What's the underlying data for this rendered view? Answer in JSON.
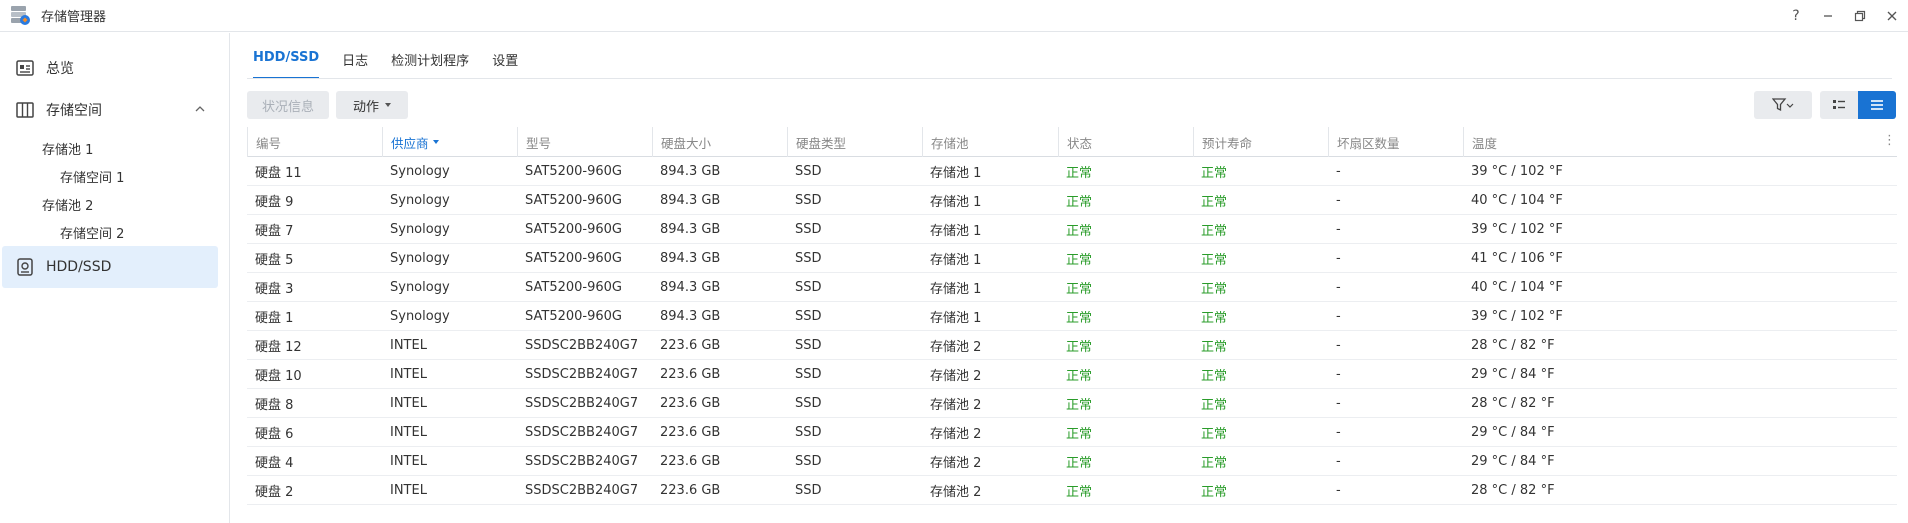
{
  "window": {
    "title": "存储管理器",
    "controls": [
      "help-icon",
      "minimize-icon",
      "restore-icon",
      "close-icon"
    ]
  },
  "sidebar": {
    "overview": "总览",
    "storage": "存储空间",
    "pools": [
      {
        "name": "存储池 1",
        "volume": "存储空间 1"
      },
      {
        "name": "存储池 2",
        "volume": "存储空间 2"
      }
    ],
    "hdd": "HDD/SSD"
  },
  "tabs": [
    "HDD/SSD",
    "日志",
    "检测计划程序",
    "设置"
  ],
  "toolbar": {
    "status_label": "状况信息",
    "action_label": "动作"
  },
  "table": {
    "columns": [
      "编号",
      "供应商",
      "型号",
      "硬盘大小",
      "硬盘类型",
      "存储池",
      "状态",
      "预计寿命",
      "坏扇区数量",
      "温度"
    ],
    "sorted_column": "供应商",
    "rows": [
      [
        "硬盘 11",
        "Synology",
        "SAT5200-960G",
        "894.3 GB",
        "SSD",
        "存储池 1",
        "正常",
        "正常",
        "-",
        "39 °C / 102 °F"
      ],
      [
        "硬盘 9",
        "Synology",
        "SAT5200-960G",
        "894.3 GB",
        "SSD",
        "存储池 1",
        "正常",
        "正常",
        "-",
        "40 °C / 104 °F"
      ],
      [
        "硬盘 7",
        "Synology",
        "SAT5200-960G",
        "894.3 GB",
        "SSD",
        "存储池 1",
        "正常",
        "正常",
        "-",
        "39 °C / 102 °F"
      ],
      [
        "硬盘 5",
        "Synology",
        "SAT5200-960G",
        "894.3 GB",
        "SSD",
        "存储池 1",
        "正常",
        "正常",
        "-",
        "41 °C / 106 °F"
      ],
      [
        "硬盘 3",
        "Synology",
        "SAT5200-960G",
        "894.3 GB",
        "SSD",
        "存储池 1",
        "正常",
        "正常",
        "-",
        "40 °C / 104 °F"
      ],
      [
        "硬盘 1",
        "Synology",
        "SAT5200-960G",
        "894.3 GB",
        "SSD",
        "存储池 1",
        "正常",
        "正常",
        "-",
        "39 °C / 102 °F"
      ],
      [
        "硬盘 12",
        "INTEL",
        "SSDSC2BB240G7",
        "223.6 GB",
        "SSD",
        "存储池 2",
        "正常",
        "正常",
        "-",
        "28 °C / 82 °F"
      ],
      [
        "硬盘 10",
        "INTEL",
        "SSDSC2BB240G7",
        "223.6 GB",
        "SSD",
        "存储池 2",
        "正常",
        "正常",
        "-",
        "29 °C / 84 °F"
      ],
      [
        "硬盘 8",
        "INTEL",
        "SSDSC2BB240G7",
        "223.6 GB",
        "SSD",
        "存储池 2",
        "正常",
        "正常",
        "-",
        "28 °C / 82 °F"
      ],
      [
        "硬盘 6",
        "INTEL",
        "SSDSC2BB240G7",
        "223.6 GB",
        "SSD",
        "存储池 2",
        "正常",
        "正常",
        "-",
        "29 °C / 84 °F"
      ],
      [
        "硬盘 4",
        "INTEL",
        "SSDSC2BB240G7",
        "223.6 GB",
        "SSD",
        "存储池 2",
        "正常",
        "正常",
        "-",
        "29 °C / 84 °F"
      ],
      [
        "硬盘 2",
        "INTEL",
        "SSDSC2BB240G7",
        "223.6 GB",
        "SSD",
        "存储池 2",
        "正常",
        "正常",
        "-",
        "28 °C / 82 °F"
      ]
    ]
  },
  "colors": {
    "accent": "#1973d3",
    "status_ok": "#2a9c2a",
    "sidebar_active": "#e3effc"
  }
}
